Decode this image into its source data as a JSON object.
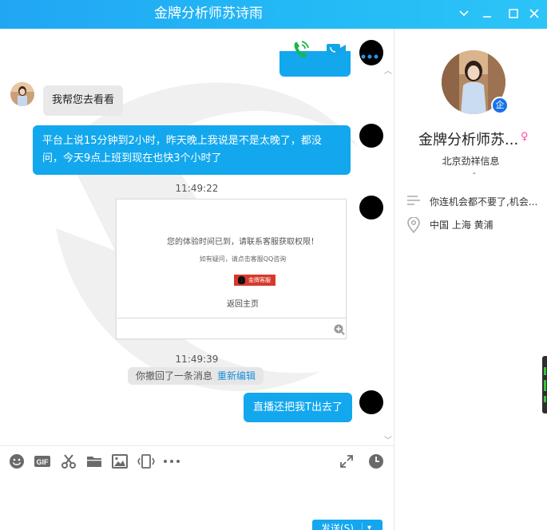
{
  "window": {
    "title": "金牌分析师苏诗雨",
    "controls": [
      "chevron-down-icon",
      "minimize-icon",
      "maximize-icon",
      "close-icon"
    ]
  },
  "chat": {
    "messages": [
      {
        "side": "left",
        "text": "我帮您去看看"
      },
      {
        "side": "right",
        "text": "平台上说15分钟到2小时，昨天晚上我说是不是太晚了，都没问，今天9点上班到现在也快3个小时了"
      },
      {
        "type": "time",
        "text": "11:49:22"
      },
      {
        "side": "right",
        "type": "image",
        "image": {
          "line1": "您的体验时间已到，请联系客服获取权限！",
          "line2": "如有疑问，请点击客服QQ咨询",
          "button": "金牌客服",
          "back": "返回主页"
        }
      },
      {
        "type": "time",
        "text": "11:49:39"
      },
      {
        "type": "recall",
        "text": "你撤回了一条消息",
        "action": "重新编辑"
      },
      {
        "side": "right",
        "text": "直播还把我T出去了"
      }
    ],
    "send_label": "发送(S)"
  },
  "profile": {
    "name": "金牌分析师苏...",
    "company": "北京劲祥信息",
    "dash": "-",
    "signature": "你连机会都不要了,机会...",
    "location": "中国 上海 黄浦",
    "badge": "企"
  },
  "colors": {
    "titlebar": "#21a6f3",
    "bubble_self": "#13a8ee",
    "bubble_other": "#e9e9e9",
    "accent_link": "#1a8fdc"
  }
}
